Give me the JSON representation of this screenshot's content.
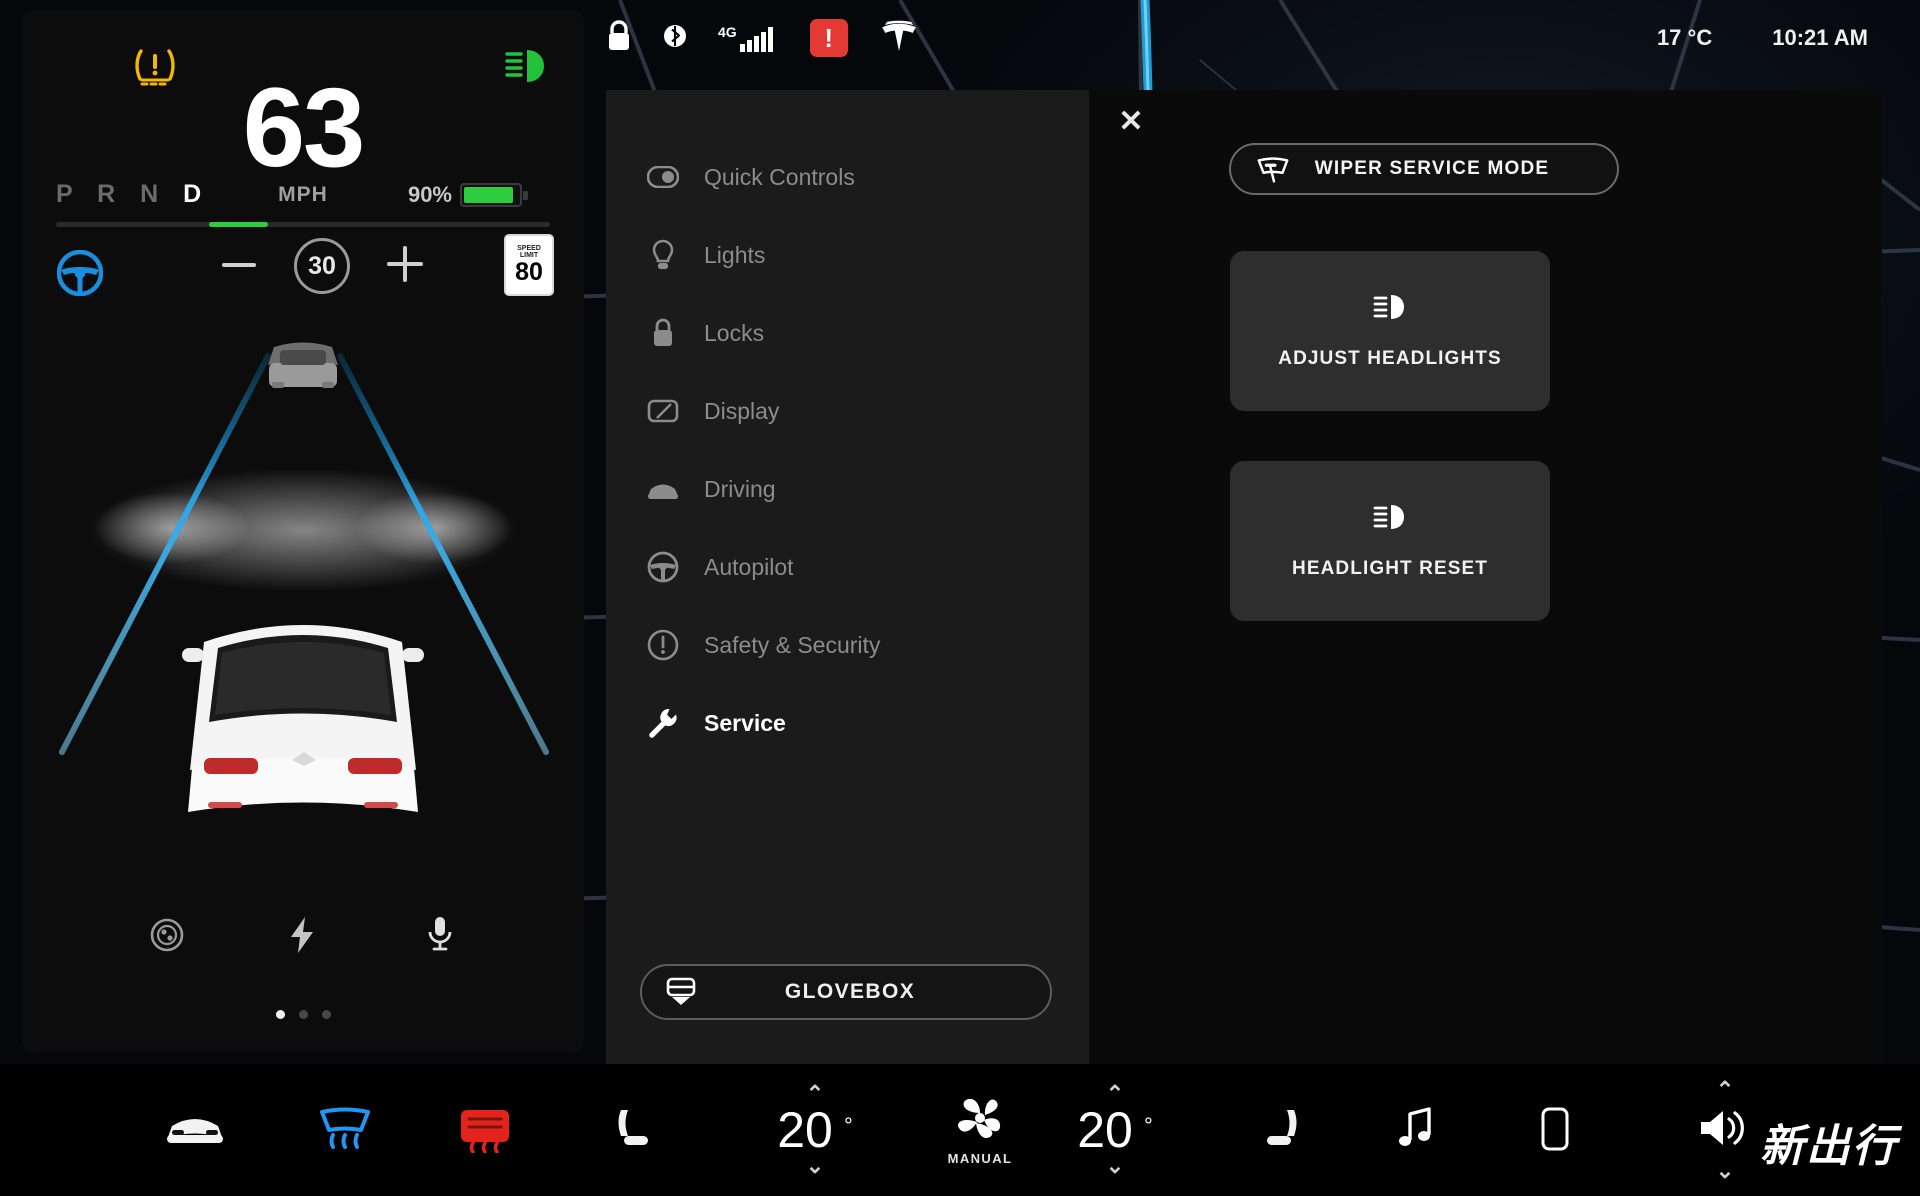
{
  "status_bar": {
    "icons": [
      "lock-icon",
      "bluetooth-icon",
      "cellular-4g-icon",
      "alert-icon",
      "tesla-logo-icon"
    ],
    "network_label": "4G",
    "alert_glyph": "!",
    "temperature": "17 °C",
    "time": "10:21 AM"
  },
  "dashboard": {
    "tpms_warning_icon": "tire-pressure-warning-icon",
    "high_beam_icon": "high-beam-icon",
    "speed": "63",
    "speed_unit": "MPH",
    "gear_letters": [
      "P",
      "R",
      "N",
      "D"
    ],
    "gear_selected": "D",
    "battery_percent": "90%",
    "battery_fill_pct": 90,
    "battery_color": "#2ecc3f",
    "autosteer_icon": "steering-wheel-icon",
    "autosteer_color": "#1a8fe0",
    "cruise_set_speed": "30",
    "decrease_label": "−",
    "increase_label": "+",
    "speed_limit_sign": {
      "line1": "SPEED",
      "line2": "LIMIT",
      "value": "80"
    },
    "bottom_icons": [
      "trip-odometer-icon",
      "energy-bolt-icon",
      "microphone-icon"
    ],
    "page_dots": 3,
    "page_dot_active": 0
  },
  "settings": {
    "close_label": "✕",
    "nav_items": [
      {
        "label": "Quick Controls",
        "icon": "toggle-switch-icon",
        "active": false
      },
      {
        "label": "Lights",
        "icon": "lightbulb-icon",
        "active": false
      },
      {
        "label": "Locks",
        "icon": "padlock-icon",
        "active": false
      },
      {
        "label": "Display",
        "icon": "display-screen-icon",
        "active": false
      },
      {
        "label": "Driving",
        "icon": "car-front-icon",
        "active": false
      },
      {
        "label": "Autopilot",
        "icon": "steering-wheel-icon",
        "active": false
      },
      {
        "label": "Safety & Security",
        "icon": "exclamation-circle-icon",
        "active": false
      },
      {
        "label": "Service",
        "icon": "wrench-icon",
        "active": true
      }
    ],
    "glovebox_button": {
      "label": "GLOVEBOX",
      "icon": "glovebox-drawer-icon"
    },
    "panel": {
      "wiper_service_button": {
        "label": "WIPER SERVICE MODE",
        "icon": "windshield-wiper-icon"
      },
      "cards": [
        {
          "label": "ADJUST HEADLIGHTS",
          "icon": "headlight-beam-icon"
        },
        {
          "label": "HEADLIGHT RESET",
          "icon": "headlight-beam-icon"
        }
      ]
    }
  },
  "climate_bar": {
    "car_button": {
      "icon": "car-front-icon"
    },
    "front_defrost": {
      "icon": "front-defrost-icon",
      "color": "#2196f3"
    },
    "rear_defrost": {
      "icon": "rear-defrost-icon",
      "color": "#e2241c"
    },
    "driver_seat_heater": {
      "icon": "seat-heater-left-icon"
    },
    "driver_temp": {
      "value": "20",
      "degree": "°",
      "up": "⌃",
      "down": "⌄"
    },
    "fan": {
      "icon": "fan-icon",
      "label": "MANUAL"
    },
    "passenger_temp": {
      "value": "20",
      "degree": "°",
      "up": "⌃",
      "down": "⌄"
    },
    "passenger_seat_heater": {
      "icon": "seat-heater-right-icon"
    },
    "media_button": {
      "icon": "music-note-icon"
    },
    "phone_button": {
      "icon": "phone-icon"
    },
    "volume": {
      "icon": "speaker-volume-icon",
      "up": "⌃",
      "down": "⌄"
    }
  },
  "watermark": {
    "text": "新出行"
  }
}
